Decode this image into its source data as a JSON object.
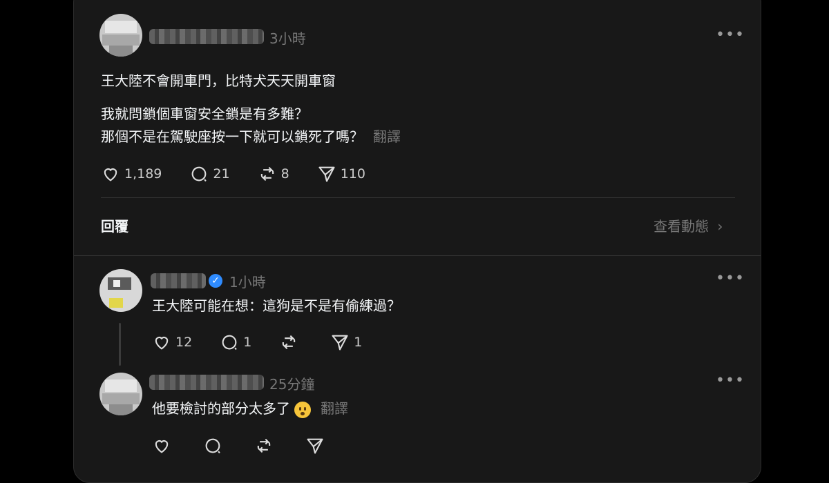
{
  "post": {
    "time": "3小時",
    "line1": "王大陸不會開車門，比特犬天天開車窗",
    "line2": "我就問鎖個車窗安全鎖是有多難？",
    "line3": "那個不是在駕駛座按一下就可以鎖死了嗎？",
    "translate": "翻譯",
    "likes": "1,189",
    "comments": "21",
    "reposts": "8",
    "shares": "110"
  },
  "replies_bar": {
    "label": "回覆",
    "view_activity": "查看動態"
  },
  "reply1": {
    "time": "1小時",
    "text": "王大陸可能在想：這狗是不是有偷練過？",
    "likes": "12",
    "comments": "1",
    "reposts": "",
    "shares": "1"
  },
  "reply2": {
    "time": "25分鐘",
    "text": "他要檢討的部分太多了",
    "translate": "翻譯"
  },
  "icons": [
    "heart-icon",
    "comment-icon",
    "repost-icon",
    "share-icon",
    "more-icon",
    "verified-icon",
    "chevron-right-icon"
  ]
}
